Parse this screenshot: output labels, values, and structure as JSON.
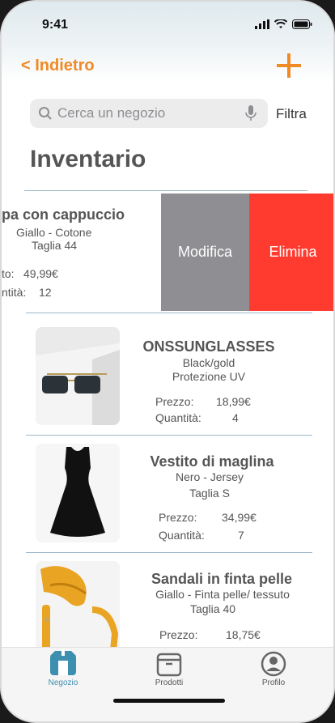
{
  "status": {
    "time": "9:41"
  },
  "nav": {
    "back_label": "< Indietro"
  },
  "search": {
    "placeholder": "Cerca un negozio",
    "filter_label": "Filtra"
  },
  "page": {
    "title": "Inventario"
  },
  "labels": {
    "price": "Prezzo:",
    "quantity": "Quantità:"
  },
  "swiped_row": {
    "name": "pa con cappuccio",
    "detail1": "Giallo - Cotone",
    "detail2": "Taglia 44",
    "price_label": "to:",
    "price": "49,99€",
    "quantity_label": "ntità:",
    "quantity": "12",
    "edit_label": "Modifica",
    "delete_label": "Elimina"
  },
  "products": [
    {
      "name": "ONSSUNGLASSES",
      "detail1": "Black/gold",
      "detail2": "Protezione UV",
      "price": "18,99€",
      "quantity": "4",
      "image_icon": "sunglasses-image"
    },
    {
      "name": "Vestito di maglina",
      "detail1": "Nero - Jersey",
      "detail2": "Taglia S",
      "price": "34,99€",
      "quantity": "7",
      "image_icon": "dress-image"
    },
    {
      "name": "Sandali in finta pelle",
      "detail1": "Giallo - Finta pelle/ tessuto",
      "detail2": "Taglia 40",
      "price": "18,75€",
      "quantity": "",
      "image_icon": "sandals-image"
    }
  ],
  "tabs": [
    {
      "label": "Negozio",
      "icon": "shop-icon",
      "active": true
    },
    {
      "label": "Prodotti",
      "icon": "box-icon",
      "active": false
    },
    {
      "label": "Profilo",
      "icon": "profile-icon",
      "active": false
    }
  ],
  "colors": {
    "accent": "#f08a24",
    "edit": "#8e8e93",
    "delete": "#ff3b30",
    "active_tab": "#3d8fb0"
  }
}
